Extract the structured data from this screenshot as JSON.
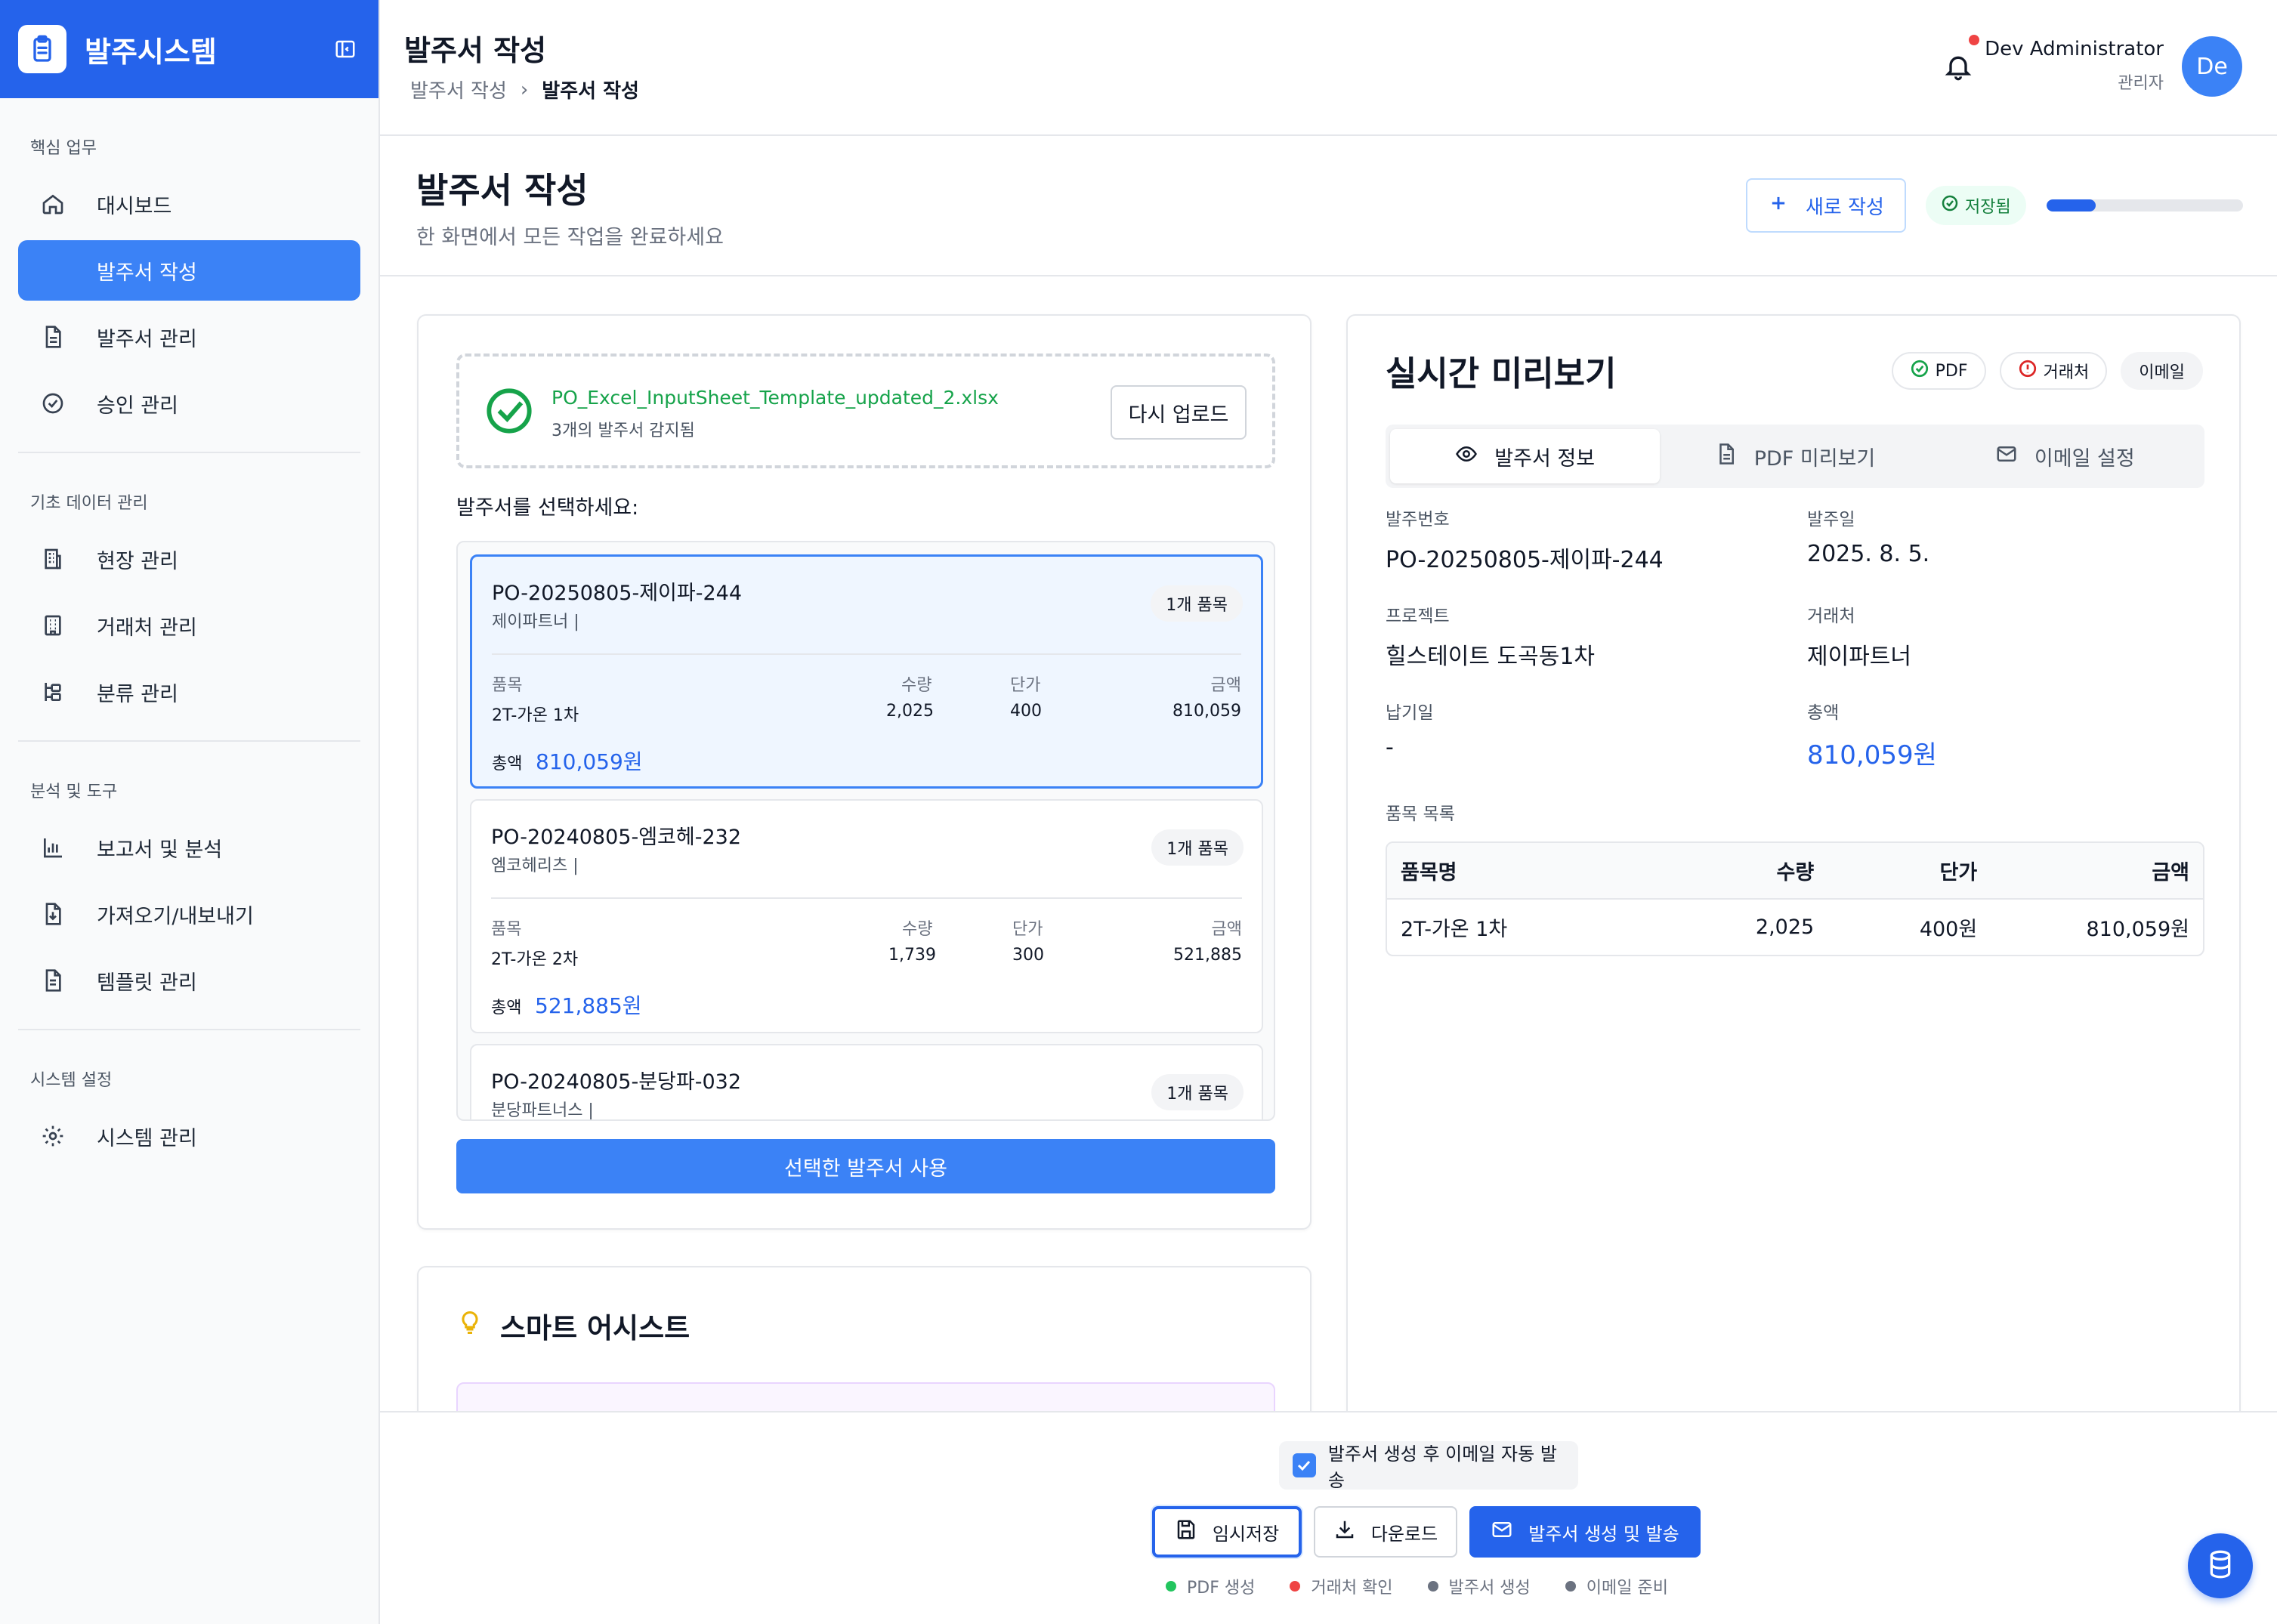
{
  "app": {
    "name": "발주시스템"
  },
  "sidebar": {
    "sections": [
      {
        "title": "핵심 업무",
        "items": [
          {
            "label": "대시보드",
            "icon": "home-icon"
          },
          {
            "label": "발주서 작성",
            "icon": "",
            "active": true
          },
          {
            "label": "발주서 관리",
            "icon": "document-icon"
          },
          {
            "label": "승인 관리",
            "icon": "check-circle-icon"
          }
        ]
      },
      {
        "title": "기초 데이터 관리",
        "items": [
          {
            "label": "현장 관리",
            "icon": "building-icon"
          },
          {
            "label": "거래처 관리",
            "icon": "office-icon"
          },
          {
            "label": "분류 관리",
            "icon": "tree-icon"
          }
        ]
      },
      {
        "title": "분석 및 도구",
        "items": [
          {
            "label": "보고서 및 분석",
            "icon": "bar-chart-icon"
          },
          {
            "label": "가져오기/내보내기",
            "icon": "file-import-icon"
          },
          {
            "label": "템플릿 관리",
            "icon": "template-icon"
          }
        ]
      },
      {
        "title": "시스템 설정",
        "items": [
          {
            "label": "시스템 관리",
            "icon": "gear-icon"
          }
        ]
      }
    ]
  },
  "header": {
    "title": "발주서 작성",
    "breadcrumb": [
      "발주서 작성",
      "발주서 작성"
    ],
    "user": {
      "name": "Dev Administrator",
      "role": "관리자",
      "initials": "De"
    }
  },
  "page": {
    "title": "발주서 작성",
    "subtitle": "한 화면에서 모든 작업을 완료하세요",
    "new_button": "새로 작성",
    "saved_badge": "저장됨",
    "progress": 0.25
  },
  "upload": {
    "filename": "PO_Excel_InputSheet_Template_updated_2.xlsx",
    "detected": "3개의 발주서 감지됨",
    "reupload": "다시 업로드"
  },
  "po_select": {
    "label": "발주서를 선택하세요:",
    "col_item": "품목",
    "col_qty": "수량",
    "col_price": "단가",
    "col_amount": "금액",
    "total_label": "총액",
    "orders": [
      {
        "number": "PO-20250805-제이파-244",
        "vendor": "제이파트너 |",
        "count": "1개 품목",
        "item": "2T-가온 1차",
        "qty": "2,025",
        "price": "400",
        "amount": "810,059",
        "total": "810,059원"
      },
      {
        "number": "PO-20240805-엠코헤-232",
        "vendor": "엠코헤리츠 |",
        "count": "1개 품목",
        "item": "2T-가온 2차",
        "qty": "1,739",
        "price": "300",
        "amount": "521,885",
        "total": "521,885원"
      },
      {
        "number": "PO-20240805-분당파-032",
        "vendor": "분당파트너스 |",
        "count": "1개 품목"
      }
    ],
    "use_button": "선택한 발주서 사용"
  },
  "assist": {
    "title": "스마트 어시스트"
  },
  "preview": {
    "title": "실시간 미리보기",
    "chips": [
      "PDF",
      "거래처",
      "이메일"
    ],
    "tabs": [
      "발주서 정보",
      "PDF 미리보기",
      "이메일 설정"
    ],
    "fields": {
      "po_number_label": "발주번호",
      "po_number": "PO-20250805-제이파-244",
      "date_label": "발주일",
      "date": "2025. 8. 5.",
      "project_label": "프로젝트",
      "project": "힐스테이트 도곡동1차",
      "vendor_label": "거래처",
      "vendor": "제이파트너",
      "due_label": "납기일",
      "due": "-",
      "total_label": "총액",
      "total": "810,059원"
    },
    "items_label": "품목 목록",
    "table_headers": [
      "품목명",
      "수량",
      "단가",
      "금액"
    ],
    "table_rows": [
      [
        "2T-가온 1차",
        "2,025",
        "400원",
        "810,059원"
      ]
    ]
  },
  "footer": {
    "auto_email": "발주서 생성 후 이메일 자동 발송",
    "temp_save": "임시저장",
    "download": "다운로드",
    "generate": "발주서 생성 및 발송",
    "steps": [
      {
        "label": "PDF 생성",
        "color": "#22c55e"
      },
      {
        "label": "거래처 확인",
        "color": "#ef4444"
      },
      {
        "label": "발주서 생성",
        "color": "#6b7280"
      },
      {
        "label": "이메일 준비",
        "color": "#6b7280"
      }
    ]
  },
  "colors": {
    "primary": "#2563eb",
    "accent": "#3b82f6",
    "success": "#16a34a",
    "danger": "#ef4444"
  }
}
